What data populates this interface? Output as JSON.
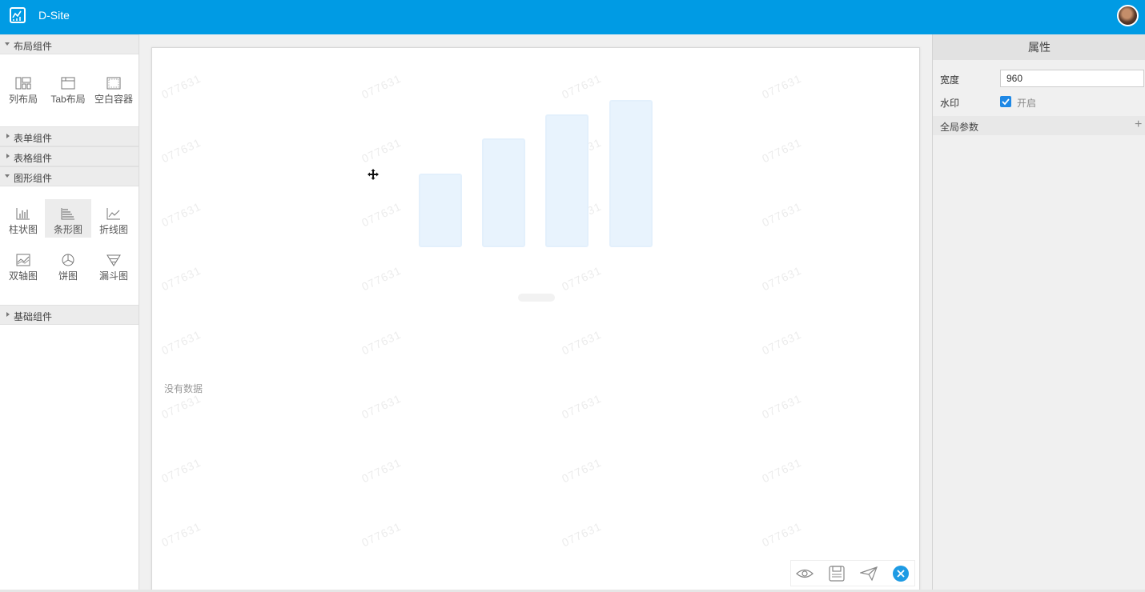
{
  "app": {
    "title": "D-Site"
  },
  "sidebar": {
    "groups": [
      {
        "label": "布局组件",
        "expanded": true,
        "items": [
          {
            "label": "列布局",
            "icon": "column-layout-icon"
          },
          {
            "label": "Tab布局",
            "icon": "tab-layout-icon"
          },
          {
            "label": "空白容器",
            "icon": "blank-container-icon"
          }
        ]
      },
      {
        "label": "表单组件",
        "expanded": false
      },
      {
        "label": "表格组件",
        "expanded": false
      },
      {
        "label": "图形组件",
        "expanded": true,
        "items": [
          {
            "label": "柱状图",
            "icon": "column-chart-icon"
          },
          {
            "label": "条形图",
            "icon": "bar-chart-icon",
            "selected": true
          },
          {
            "label": "折线图",
            "icon": "line-chart-icon"
          },
          {
            "label": "双轴图",
            "icon": "dual-axis-chart-icon"
          },
          {
            "label": "饼图",
            "icon": "pie-chart-icon"
          },
          {
            "label": "漏斗图",
            "icon": "funnel-chart-icon"
          }
        ]
      },
      {
        "label": "基础组件",
        "expanded": false
      }
    ]
  },
  "canvas": {
    "watermark": "077631",
    "placeholder_bar_levels": [
      0.5,
      0.74,
      0.9,
      1.0
    ],
    "empty_text": "没有数据",
    "toolbar": [
      {
        "icon": "eye-icon"
      },
      {
        "icon": "save-icon"
      },
      {
        "icon": "send-icon"
      },
      {
        "icon": "close-icon"
      }
    ]
  },
  "properties": {
    "title": "属性",
    "width_label": "宽度",
    "width_value": "960",
    "watermark_label": "水印",
    "watermark_checked": true,
    "watermark_option": "开启",
    "global_params_label": "全局参数",
    "add_symbol": "+"
  },
  "colors": {
    "topbar": "#009be4",
    "accent": "#1e88e5",
    "placeholder_bar": "#e8f3fd"
  }
}
